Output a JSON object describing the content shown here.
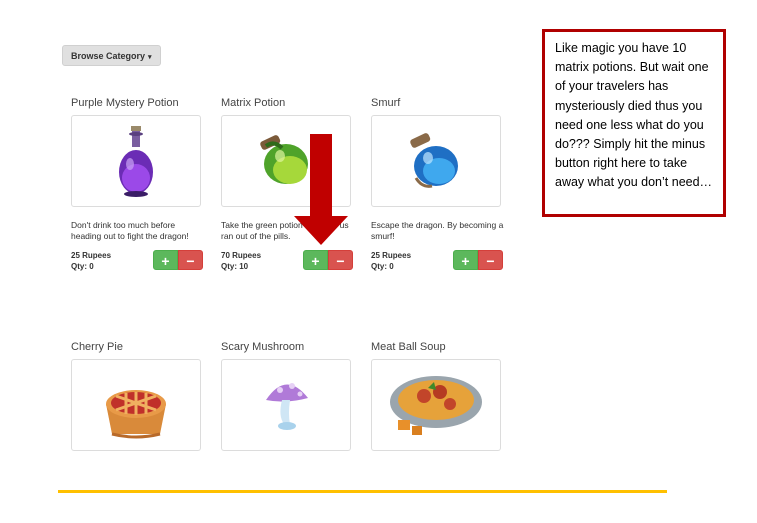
{
  "browse": {
    "label": "Browse Category",
    "caret": "▾"
  },
  "products": [
    {
      "name": "Purple Mystery Potion",
      "icon": "purple-potion-icon",
      "description": "Don't drink too much before heading out to fight the dragon!",
      "price": "25 Rupees",
      "qty": "Qty: 0"
    },
    {
      "name": "Matrix Potion",
      "icon": "green-potion-icon",
      "description": "Take the green potion because us ran out of the pills.",
      "price": "70 Rupees",
      "qty": "Qty: 10"
    },
    {
      "name": "Smurf",
      "icon": "blue-potion-icon",
      "description": "Escape the dragon. By becoming a smurf!",
      "price": "25 Rupees",
      "qty": "Qty: 0"
    },
    {
      "name": "Cherry Pie",
      "icon": "cherry-pie-icon"
    },
    {
      "name": "Scary Mushroom",
      "icon": "mushroom-icon"
    },
    {
      "name": "Meat Ball Soup",
      "icon": "meatball-soup-icon"
    }
  ],
  "buttons": {
    "plus": "+",
    "minus": "−"
  },
  "callout": {
    "text": "Like magic you have 10 matrix potions. But wait one of your travelers has mysteriously died thus you need one less what do you do??? Simply hit the minus button right here to take away what you don’t need…"
  },
  "colors": {
    "callout_border": "#b00000",
    "arrow": "#c00000",
    "plus_button": "#5cb85c",
    "minus_button": "#d9534f",
    "underline": "#ffc000"
  }
}
